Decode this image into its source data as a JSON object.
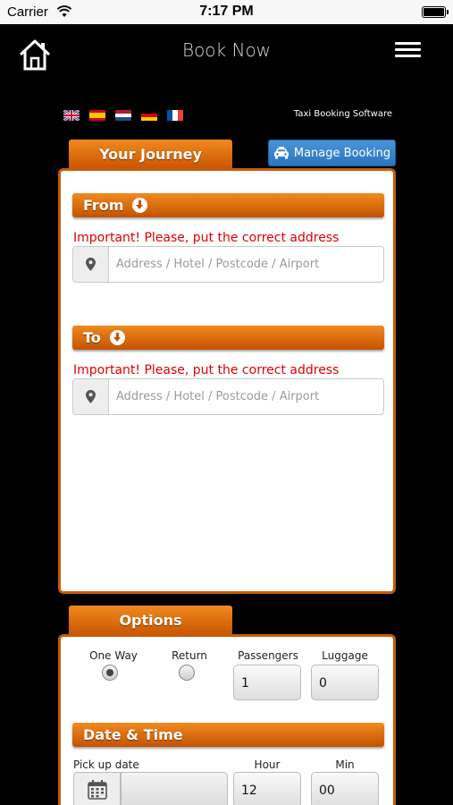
{
  "status_bar": {
    "carrier": "Carrier",
    "time": "7:17 PM",
    "battery_level": 1.0
  },
  "header": {
    "title": "Book Now",
    "home_icon": "home-icon",
    "menu_icon": "hamburger-menu-icon"
  },
  "languages": [
    {
      "name": "flag-uk"
    },
    {
      "name": "flag-spain"
    },
    {
      "name": "flag-netherlands"
    },
    {
      "name": "flag-germany"
    },
    {
      "name": "flag-france"
    }
  ],
  "tagline": "Taxi Booking Software",
  "journey": {
    "tab_label": "Your Journey",
    "manage_button_label": "Manage Booking",
    "from": {
      "label": "From",
      "warning": "Important! Please, put the correct address",
      "placeholder": "Address / Hotel / Postcode / Airport",
      "value": ""
    },
    "to": {
      "label": "To",
      "warning": "Important! Please, put the correct address",
      "placeholder": "Address / Hotel / Postcode / Airport",
      "value": ""
    }
  },
  "options": {
    "tab_label": "Options",
    "one_way_label": "One Way",
    "return_label": "Return",
    "trip_type_selected": "One Way",
    "passengers_label": "Passengers",
    "passengers_value": "1",
    "luggage_label": "Luggage",
    "luggage_value": "0",
    "datetime_label": "Date & Time",
    "pickup_date_label": "Pick up date",
    "pickup_date_value": "",
    "hour_label": "Hour",
    "hour_value": "12",
    "min_label": "Min",
    "min_value": "00"
  },
  "colors": {
    "accent_orange": "#e06a10",
    "panel_border": "#c75b0a",
    "manage_blue": "#2f7cc8",
    "warning_red": "#e00000"
  }
}
